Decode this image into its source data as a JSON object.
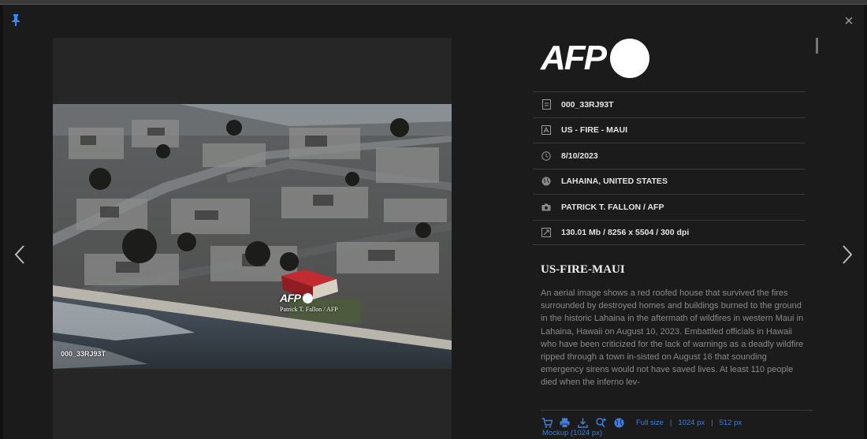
{
  "colors": {
    "accent": "#3d7fe0",
    "pin": "#2d8cff",
    "roof": "#b3282d"
  },
  "photo": {
    "id_caption": "000_33RJ93T",
    "watermark_logo": "AFP",
    "watermark_credit": "Patrick T. Fallon / AFP"
  },
  "sidebar": {
    "logo_text": "AFP",
    "metadata": [
      {
        "icon": "file-icon",
        "value": "000_33RJ93T"
      },
      {
        "icon": "text-icon",
        "value": "US - FIRE - MAUI"
      },
      {
        "icon": "clock-icon",
        "value": "8/10/2023"
      },
      {
        "icon": "globe-icon",
        "value": "LAHAINA, UNITED STATES"
      },
      {
        "icon": "camera-icon",
        "value": "PATRICK T. FALLON / AFP"
      },
      {
        "icon": "resize-icon",
        "value": "130.01 Mb / 8256 x 5504 / 300 dpi"
      }
    ],
    "story_title": "US-FIRE-MAUI",
    "story_body": "An aerial image shows a red roofed house that survived the fires surrounded by destroyed homes and buildings burned to the ground in the historic Lahaina in the aftermath of wildfires in western Maui in Lahaina, Hawaii on August 10, 2023. Embattled officials in Hawaii who have been criticized for the lack of warnings as a deadly wildfire ripped through a town in-sisted on August 16 that sounding emergency sirens would not have saved lives. At least 110 people died when the inferno lev-",
    "actions": {
      "icons": [
        "cart-icon",
        "print-icon",
        "download-icon",
        "zoom-in-icon",
        "globe-icon"
      ],
      "sizes": [
        "Full size",
        "1024 px",
        "512 px"
      ],
      "separator": "|",
      "mockup": "Mockup (1024 px)"
    }
  }
}
